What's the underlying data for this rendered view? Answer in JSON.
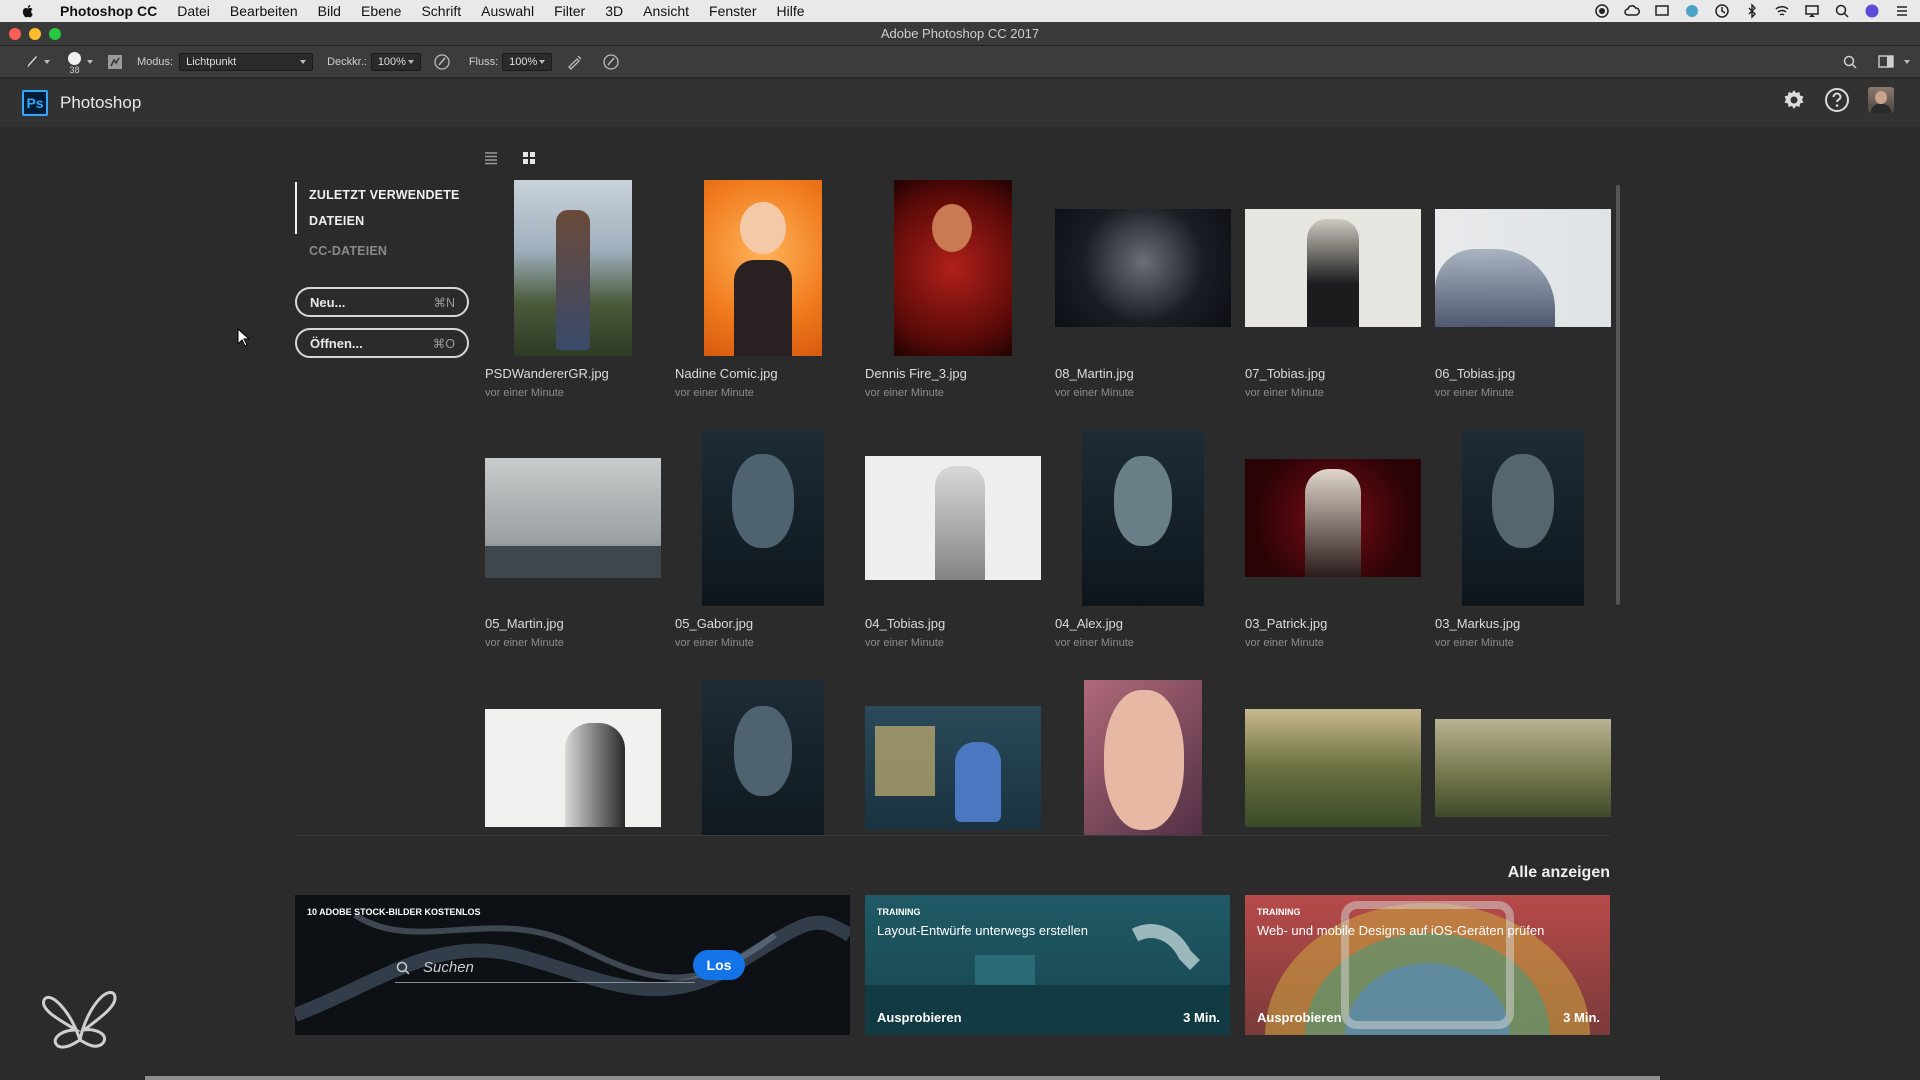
{
  "menubar": {
    "items": [
      "Photoshop CC",
      "Datei",
      "Bearbeiten",
      "Bild",
      "Ebene",
      "Schrift",
      "Auswahl",
      "Filter",
      "3D",
      "Ansicht",
      "Fenster",
      "Hilfe"
    ]
  },
  "window": {
    "title": "Adobe Photoshop CC 2017"
  },
  "options": {
    "brush_size": "38",
    "mode_label": "Modus:",
    "mode_value": "Lichtpunkt",
    "opacity_label": "Deckkr.:",
    "opacity_value": "100%",
    "flow_label": "Fluss:",
    "flow_value": "100%"
  },
  "header": {
    "logo": "Ps",
    "app_name": "Photoshop"
  },
  "sidebar": {
    "recent_label_1": "ZULETZT VERWENDETE",
    "recent_label_2": "DATEIEN",
    "cc_label": "CC-DATEIEN",
    "new_label": "Neu...",
    "new_shortcut": "⌘N",
    "open_label": "Öffnen...",
    "open_shortcut": "⌘O"
  },
  "files": [
    {
      "name": "PSDWandererGR.jpg",
      "time": "vor einer Minute"
    },
    {
      "name": "Nadine Comic.jpg",
      "time": "vor einer Minute"
    },
    {
      "name": "Dennis Fire_3.jpg",
      "time": "vor einer Minute"
    },
    {
      "name": "08_Martin.jpg",
      "time": "vor einer Minute"
    },
    {
      "name": "07_Tobias.jpg",
      "time": "vor einer Minute"
    },
    {
      "name": "06_Tobias.jpg",
      "time": "vor einer Minute"
    },
    {
      "name": "05_Martin.jpg",
      "time": "vor einer Minute"
    },
    {
      "name": "05_Gabor.jpg",
      "time": "vor einer Minute"
    },
    {
      "name": "04_Tobias.jpg",
      "time": "vor einer Minute"
    },
    {
      "name": "04_Alex.jpg",
      "time": "vor einer Minute"
    },
    {
      "name": "03_Patrick.jpg",
      "time": "vor einer Minute"
    },
    {
      "name": "03_Markus.jpg",
      "time": "vor einer Minute"
    }
  ],
  "learn": {
    "see_all": "Alle anzeigen",
    "stock": {
      "heading": "10 ADOBE STOCK-BILDER KOSTENLOS",
      "search_placeholder": "Suchen",
      "button": "Los"
    },
    "cards": [
      {
        "kicker": "TRAINING",
        "title": "Layout-Entwürfe unterwegs erstellen",
        "cta": "Ausprobieren",
        "duration": "3 Min."
      },
      {
        "kicker": "TRAINING",
        "title": "Web- und mobile Designs auf iOS-Geräten prüfen",
        "cta": "Ausprobieren",
        "duration": "3 Min."
      }
    ]
  },
  "colors": {
    "accent": "#1473e6",
    "ps_blue": "#31a8ff",
    "background": "#2b2b2b"
  }
}
